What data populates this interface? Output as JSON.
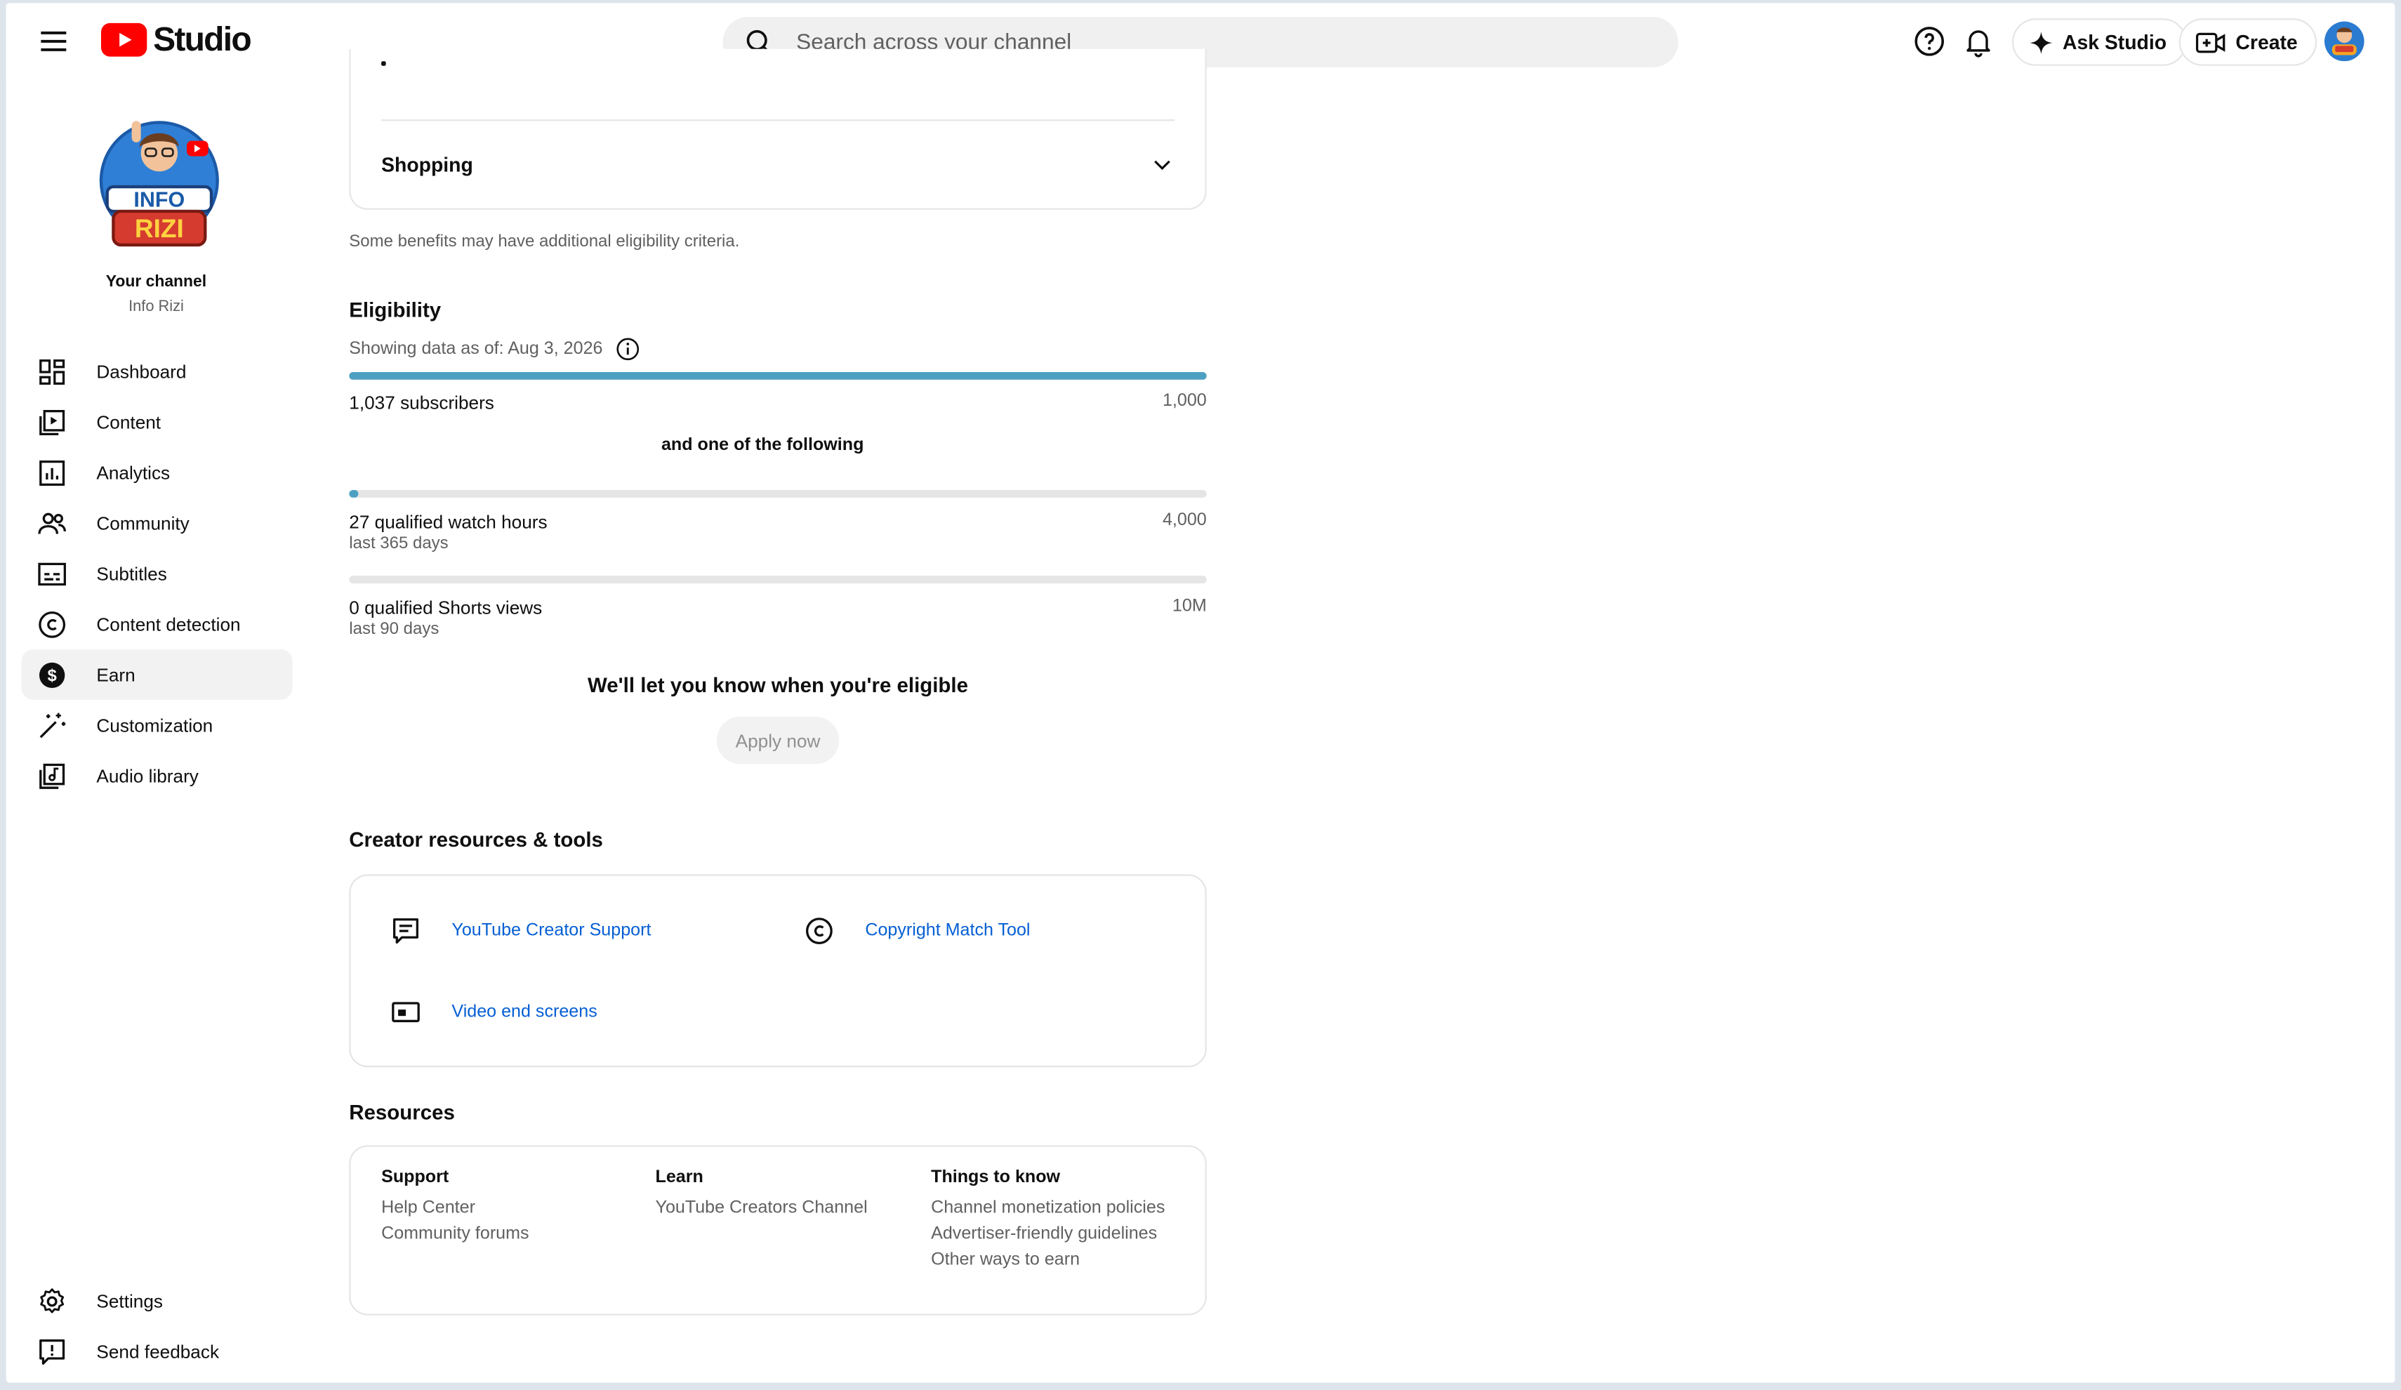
{
  "app": {
    "name": "Studio"
  },
  "search": {
    "placeholder": "Search across your channel"
  },
  "header": {
    "ask_studio": "Ask Studio",
    "create": "Create"
  },
  "channel": {
    "title": "Your channel",
    "name": "Info Rizi",
    "logo_lines": [
      "INFO",
      "RIZI"
    ]
  },
  "sidebar": {
    "items": [
      {
        "label": "Dashboard",
        "icon": "dashboard-icon"
      },
      {
        "label": "Content",
        "icon": "content-icon"
      },
      {
        "label": "Analytics",
        "icon": "analytics-icon"
      },
      {
        "label": "Community",
        "icon": "community-icon"
      },
      {
        "label": "Subtitles",
        "icon": "subtitles-icon"
      },
      {
        "label": "Content detection",
        "icon": "copyright-icon"
      },
      {
        "label": "Earn",
        "icon": "dollar-icon",
        "active": true
      },
      {
        "label": "Customization",
        "icon": "magic-wand-icon"
      },
      {
        "label": "Audio library",
        "icon": "music-library-icon"
      }
    ],
    "bottom": [
      {
        "label": "Settings",
        "icon": "gear-icon"
      },
      {
        "label": "Send feedback",
        "icon": "feedback-icon"
      }
    ]
  },
  "benefits": {
    "shopping_label": "Shopping",
    "note": "Some benefits may have additional eligibility criteria."
  },
  "eligibility": {
    "title": "Eligibility",
    "as_of": "Showing data as of: Aug 3, 2026",
    "subscribers": {
      "label": "1,037 subscribers",
      "target": "1,000",
      "progress": 1.0
    },
    "and_one": "and one of the following",
    "watch_hours": {
      "label": "27 qualified watch hours",
      "sub": "last 365 days",
      "target": "4,000",
      "progress": 0.0068
    },
    "shorts_views": {
      "label": "0 qualified Shorts views",
      "sub": "last 90 days",
      "target": "10M",
      "progress": 0
    },
    "notify": "We'll let you know when you're eligible",
    "apply": "Apply now"
  },
  "creator_tools": {
    "title": "Creator resources & tools",
    "items": [
      {
        "label": "YouTube Creator Support",
        "icon": "chat-icon"
      },
      {
        "label": "Copyright Match Tool",
        "icon": "copyright-icon"
      },
      {
        "label": "Video end screens",
        "icon": "end-screen-icon"
      }
    ]
  },
  "resources": {
    "title": "Resources",
    "support": {
      "heading": "Support",
      "links": [
        "Help Center",
        "Community forums"
      ]
    },
    "learn": {
      "heading": "Learn",
      "links": [
        "YouTube Creators Channel"
      ]
    },
    "things": {
      "heading": "Things to know",
      "links": [
        "Channel monetization policies",
        "Advertiser-friendly guidelines",
        "Other ways to earn"
      ]
    }
  },
  "colors": {
    "accent": "#4ea0c2",
    "link": "#065fd4",
    "brand_red": "#ff0000"
  }
}
